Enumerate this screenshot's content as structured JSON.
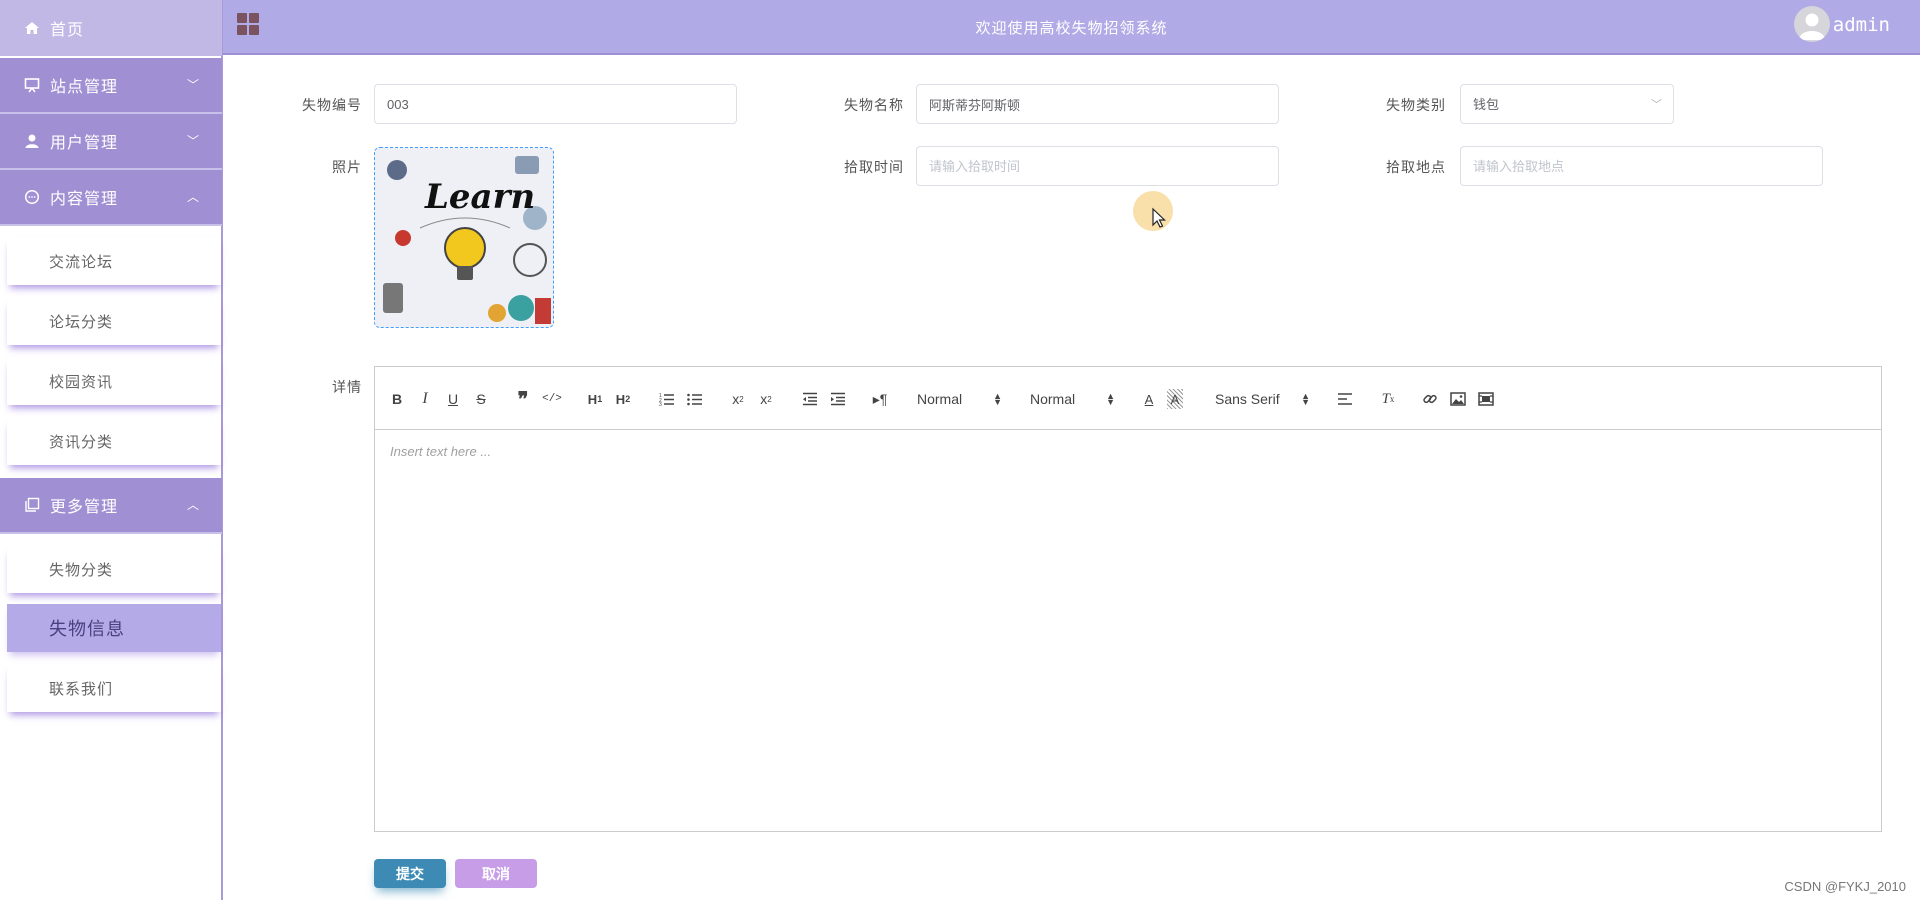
{
  "sidebar": {
    "home": {
      "label": "首页",
      "icon": "home-icon"
    },
    "menus": [
      {
        "label": "站点管理",
        "icon": "monitor-icon",
        "expanded": false
      },
      {
        "label": "用户管理",
        "icon": "user-icon",
        "expanded": false
      },
      {
        "label": "内容管理",
        "icon": "chat-icon",
        "expanded": true
      },
      {
        "label": "更多管理",
        "icon": "copy-icon",
        "expanded": true
      }
    ],
    "content_items": [
      "交流论坛",
      "论坛分类",
      "校园资讯",
      "资讯分类"
    ],
    "more_items": [
      "失物分类",
      "失物信息",
      "联系我们"
    ],
    "active_item": "失物信息"
  },
  "header": {
    "title": "欢迎使用高校失物招领系统",
    "user": "admin"
  },
  "form": {
    "item_no": {
      "label": "失物编号",
      "value": "003"
    },
    "item_name": {
      "label": "失物名称",
      "value": "阿斯蒂芬阿斯顿"
    },
    "category": {
      "label": "失物类别",
      "value": "钱包"
    },
    "photo": {
      "label": "照片",
      "image_text": "Learn"
    },
    "pickup_time": {
      "label": "拾取时间",
      "placeholder": "请输入拾取时间"
    },
    "pickup_place": {
      "label": "拾取地点",
      "placeholder": "请输入拾取地点"
    },
    "details": {
      "label": "详情",
      "placeholder": "Insert text here ..."
    }
  },
  "editor": {
    "header_select": "Normal",
    "size_select": "Normal",
    "font_select": "Sans Serif"
  },
  "buttons": {
    "submit": "提交",
    "cancel": "取消"
  },
  "watermark": "CSDN @FYKJ_2010",
  "colors": {
    "header": "#b0aae6",
    "menu": "#a08fd2",
    "home": "#c2b8e6",
    "active_item": "#b4aae8",
    "submit": "#3d8bb5",
    "cancel": "#c79de8"
  }
}
